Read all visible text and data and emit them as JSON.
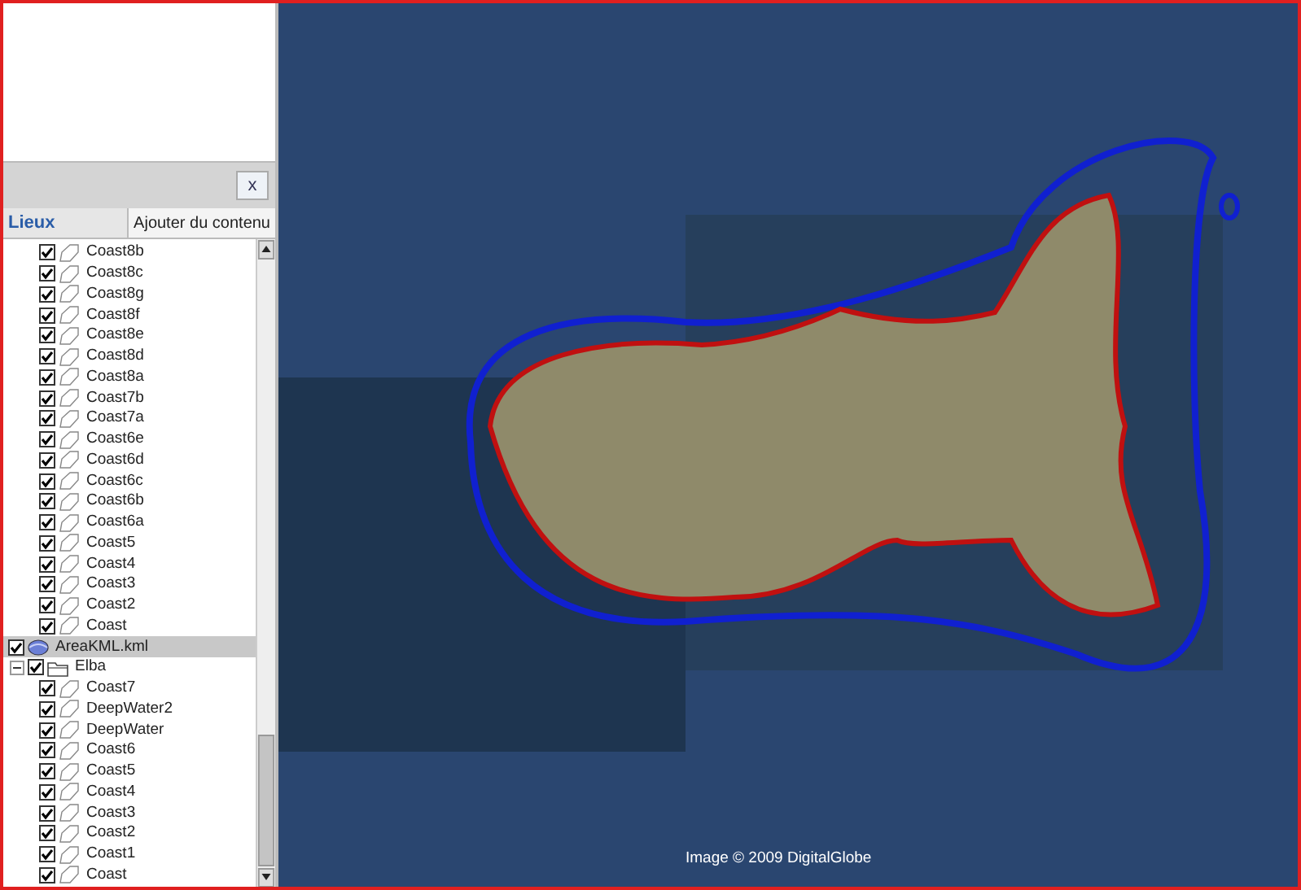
{
  "close_button": "x",
  "tabs": [
    {
      "label": "Lieux",
      "selected": true
    },
    {
      "label": "Ajouter du contenu",
      "selected": false
    }
  ],
  "tree": {
    "hidden_branch_items": [
      {
        "label": "Coast8b",
        "checked": true
      },
      {
        "label": "Coast8c",
        "checked": true
      },
      {
        "label": "Coast8g",
        "checked": true
      },
      {
        "label": "Coast8f",
        "checked": true
      },
      {
        "label": "Coast8e",
        "checked": true
      },
      {
        "label": "Coast8d",
        "checked": true
      },
      {
        "label": "Coast8a",
        "checked": true
      },
      {
        "label": "Coast7b",
        "checked": true
      },
      {
        "label": "Coast7a",
        "checked": true
      },
      {
        "label": "Coast6e",
        "checked": true
      },
      {
        "label": "Coast6d",
        "checked": true
      },
      {
        "label": "Coast6c",
        "checked": true
      },
      {
        "label": "Coast6b",
        "checked": true
      },
      {
        "label": "Coast6a",
        "checked": true
      },
      {
        "label": "Coast5",
        "checked": true
      },
      {
        "label": "Coast4",
        "checked": true
      },
      {
        "label": "Coast3",
        "checked": true
      },
      {
        "label": "Coast2",
        "checked": true
      },
      {
        "label": "Coast",
        "checked": true
      }
    ],
    "nodes": [
      {
        "label": "AreaKML.kml",
        "kind": "file",
        "checked": true,
        "selected": true,
        "children": [
          {
            "label": "Elba",
            "kind": "folder",
            "checked": true,
            "expanded": true,
            "selected": false,
            "children": [
              {
                "label": "Coast7",
                "kind": "polygon",
                "checked": true,
                "selected": false
              },
              {
                "label": "DeepWater2",
                "kind": "polygon",
                "checked": true,
                "selected": false
              },
              {
                "label": "DeepWater",
                "kind": "polygon",
                "checked": true,
                "selected": false
              },
              {
                "label": "Coast6",
                "kind": "polygon",
                "checked": true,
                "selected": false
              },
              {
                "label": "Coast5",
                "kind": "polygon",
                "checked": true,
                "selected": false
              },
              {
                "label": "Coast4",
                "kind": "polygon",
                "checked": true,
                "selected": false
              },
              {
                "label": "Coast3",
                "kind": "polygon",
                "checked": true,
                "selected": false
              },
              {
                "label": "Coast2",
                "kind": "polygon",
                "checked": true,
                "selected": false
              },
              {
                "label": "Coast1",
                "kind": "polygon",
                "checked": true,
                "selected": false
              },
              {
                "label": "Coast",
                "kind": "polygon",
                "checked": true,
                "selected": false
              }
            ]
          }
        ]
      }
    ]
  },
  "map": {
    "attribution": "Image © 2009 DigitalGlobe"
  }
}
